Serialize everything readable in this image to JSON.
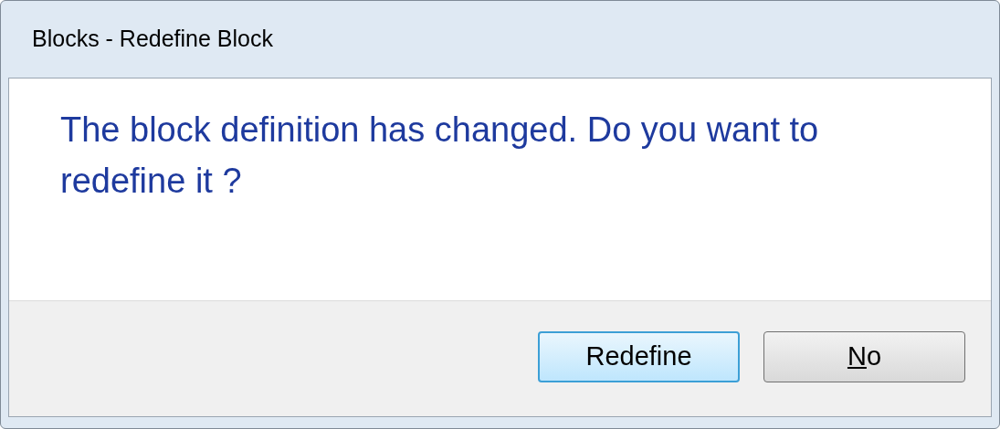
{
  "window": {
    "title": "Blocks - Redefine Block"
  },
  "message": "The block definition has changed. Do you want to redefine it ?",
  "buttons": [
    {
      "focused": true,
      "label_parts": [
        {
          "text": "Redefine",
          "underlined": false
        }
      ]
    },
    {
      "focused": false,
      "label_parts": [
        {
          "text": "N",
          "underlined": true
        },
        {
          "text": "o",
          "underlined": false
        }
      ]
    }
  ]
}
